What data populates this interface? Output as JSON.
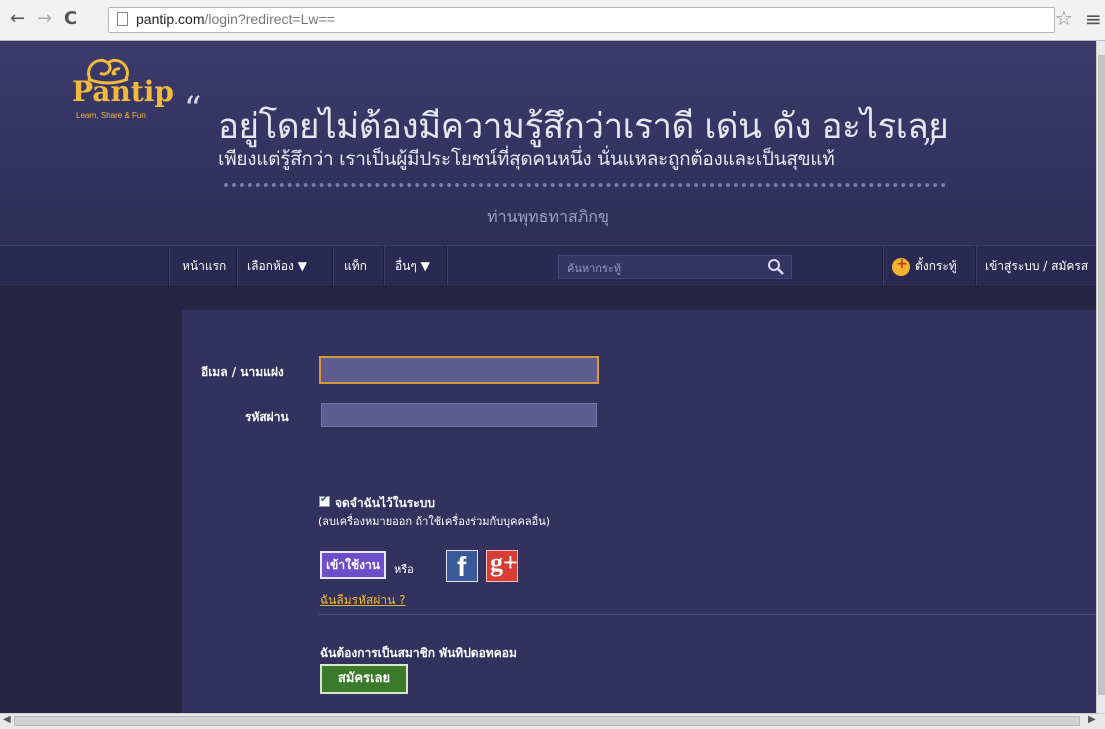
{
  "browser": {
    "url_host": "pantip.com",
    "url_path": "/login?redirect=Lw=="
  },
  "header": {
    "logo_text": "Pantip",
    "logo_tagline": "Learn, Share & Fun",
    "quote_line1": "อยู่โดยไม่ต้องมีความรู้สึกว่าเราดี เด่น ดัง อะไรเลย",
    "quote_line2": "เพียงแต่รู้สึกว่า เราเป็นผู้มีประโยชน์ที่สุดคนหนึ่ง นั่นแหละถูกต้องและเป็นสุขแท้",
    "quote_author": "ท่านพุทธทาสภิกขุ"
  },
  "navbar": {
    "home": "หน้าแรก",
    "choose_room": "เลือกห้อง ▼",
    "tags": "แท็ก",
    "others": "อื่นๆ ▼",
    "search_placeholder": "ค้นหากระทู้",
    "new_topic": "ตั้งกระทู้",
    "login_register": "เข้าสู่ระบบ / สมัครส"
  },
  "login_form": {
    "email_label": "อีเมล / นามแฝง",
    "email_value": "",
    "password_label": "รหัสผ่าน",
    "password_value": "",
    "remember_label": "จดจำฉันไว้ในระบบ",
    "remember_checked": true,
    "remember_note": "(ลบเครื่องหมายออก ถ้าใช้เครื่องร่วมกับบุคคลอื่น)",
    "login_button": "เข้าใช้งาน",
    "or_text": "หรือ",
    "facebook_glyph": "f",
    "google_glyph": "g+",
    "forgot_password": "ฉันลืมรหัสผ่าน ?",
    "signup_prompt": "ฉันต้องการเป็นสมาชิก พันทิปดอทคอม",
    "signup_button": "สมัครเลย"
  },
  "colors": {
    "page_bg": "#252443",
    "header_bg": "#3b3a6b",
    "accent_yellow": "#f2bd2a",
    "login_button": "#6c4ec9",
    "signup_button": "#3b7a2a",
    "facebook": "#3b5998",
    "google": "#d73d32"
  }
}
